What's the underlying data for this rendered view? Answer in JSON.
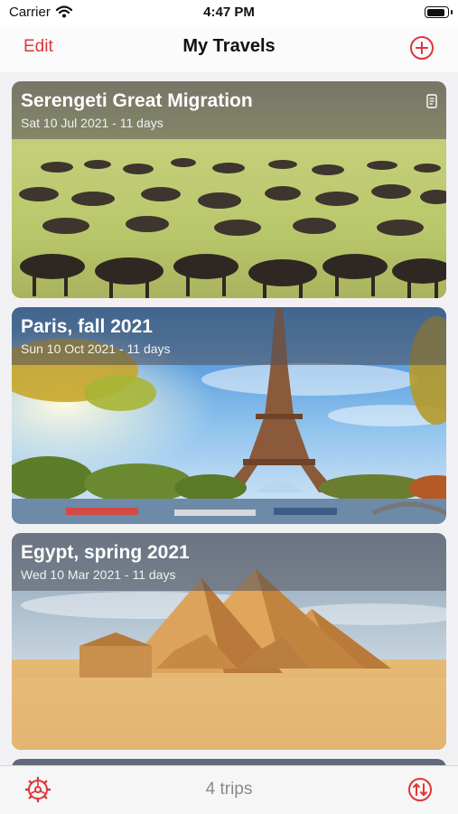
{
  "status_bar": {
    "carrier": "Carrier",
    "time": "4:47 PM",
    "battery_level": 0.9
  },
  "nav": {
    "edit_label": "Edit",
    "title": "My Travels",
    "add_icon": "plus-circle-icon"
  },
  "trips": [
    {
      "title": "Serengeti Great Migration",
      "subtitle": "Sat 10 Jul 2021 -  11 days",
      "image": "wildebeest-herd",
      "has_notes": true
    },
    {
      "title": "Paris, fall 2021",
      "subtitle": "Sun 10 Oct 2021 -  11 days",
      "image": "eiffel-tower"
    },
    {
      "title": "Egypt, spring 2021",
      "subtitle": "Wed 10 Mar 2021 -  11 days",
      "image": "pyramids"
    }
  ],
  "tab_bar": {
    "count_label": "4 trips",
    "settings_icon": "gear-icon",
    "sort_icon": "sort-arrows-icon"
  },
  "colors": {
    "accent": "#e0353a"
  }
}
